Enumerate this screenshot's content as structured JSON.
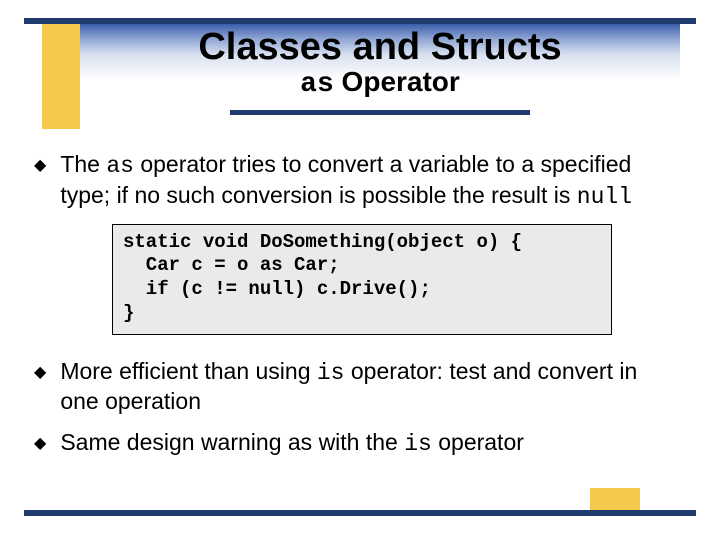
{
  "title": "Classes and Structs",
  "subtitle_mono": "as",
  "subtitle_rest": " Operator",
  "bullets": [
    {
      "pre": "The ",
      "mono1": "as",
      "mid": " operator tries to convert a variable to a specified type; if no such conversion is possible the result is ",
      "mono2": "null",
      "post": ""
    },
    {
      "pre": "More efficient than using ",
      "mono1": "is",
      "mid": " operator: test and convert in one operation",
      "mono2": "",
      "post": ""
    },
    {
      "pre": "Same design warning as with the ",
      "mono1": "is",
      "mid": " operator",
      "mono2": "",
      "post": ""
    }
  ],
  "code": "static void DoSomething(object o) {\n  Car c = o as Car;\n  if (c != null) c.Drive();\n}",
  "colors": {
    "navy": "#1f3a6f",
    "gold": "#f4c84a",
    "codebg": "#eaeaea"
  }
}
